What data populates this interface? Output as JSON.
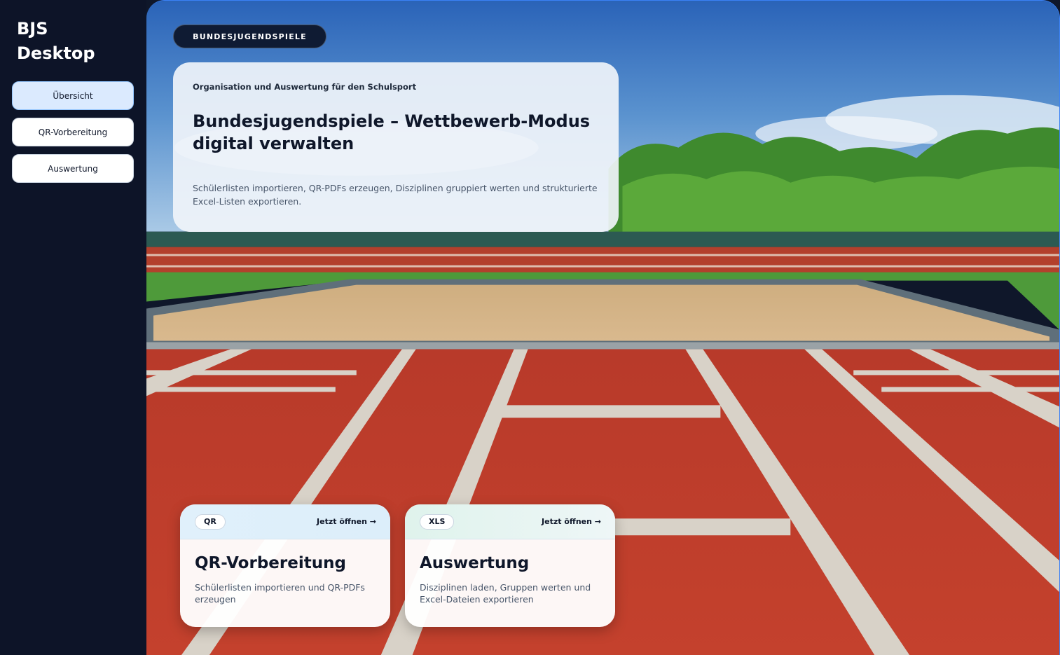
{
  "sidebar": {
    "app_title": "BJS Desktop",
    "nav": [
      {
        "label": "Übersicht",
        "active": true
      },
      {
        "label": "QR-Vorbereitung",
        "active": false
      },
      {
        "label": "Auswertung",
        "active": false
      }
    ]
  },
  "hero": {
    "badge": "BUNDESJUGENDSPIELE",
    "eyebrow": "Organisation und Auswertung für den Schulsport",
    "title": "Bundesjugendspiele – Wettbewerb-Modus digital verwalten",
    "description": "Schülerlisten importieren, QR-PDFs erzeugen, Disziplinen gruppiert werten und strukturierte Excel-Listen exportieren."
  },
  "tiles": [
    {
      "chip": "QR",
      "link": "Jetzt öffnen →",
      "title": "QR-Vorbereitung",
      "description": "Schülerlisten importieren und QR-PDFs erzeugen"
    },
    {
      "chip": "XLS",
      "link": "Jetzt öffnen →",
      "title": "Auswertung",
      "description": "Disziplinen laden, Gruppen werten und Excel-Dateien exportieren"
    }
  ],
  "colors": {
    "sidebar_bg": "#0d1428",
    "active_nav": "#dbeafe",
    "track_red": "#c0392b",
    "sand": "#d6b489",
    "grass": "#4e9a3a"
  }
}
